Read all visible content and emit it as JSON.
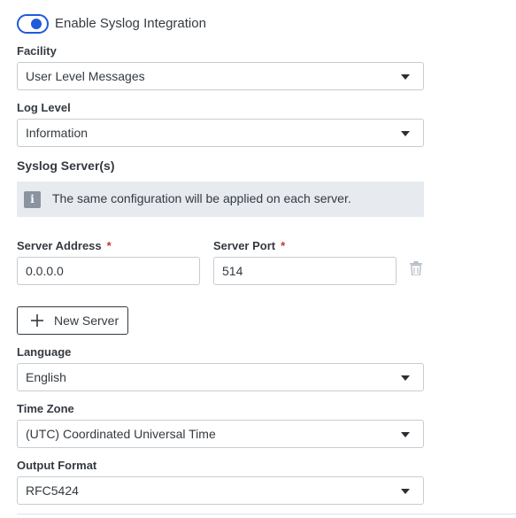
{
  "toggle": {
    "label": "Enable Syslog Integration",
    "enabled": true
  },
  "facility": {
    "label": "Facility",
    "value": "User Level Messages"
  },
  "log_level": {
    "label": "Log Level",
    "value": "Information"
  },
  "servers": {
    "title": "Syslog Server(s)",
    "info": "The same configuration will be applied on each server.",
    "address_label": "Server Address",
    "port_label": "Server Port",
    "required_mark": "*",
    "address_value": "0.0.0.0",
    "port_value": "514",
    "new_server_label": "New Server"
  },
  "language": {
    "label": "Language",
    "value": "English"
  },
  "timezone": {
    "label": "Time Zone",
    "value": "(UTC) Coordinated Universal Time"
  },
  "output_format": {
    "label": "Output Format",
    "value": "RFC5424"
  },
  "colors": {
    "accent": "#1f5bd8",
    "required": "#c0392b",
    "info_bg": "#e7eaee"
  }
}
